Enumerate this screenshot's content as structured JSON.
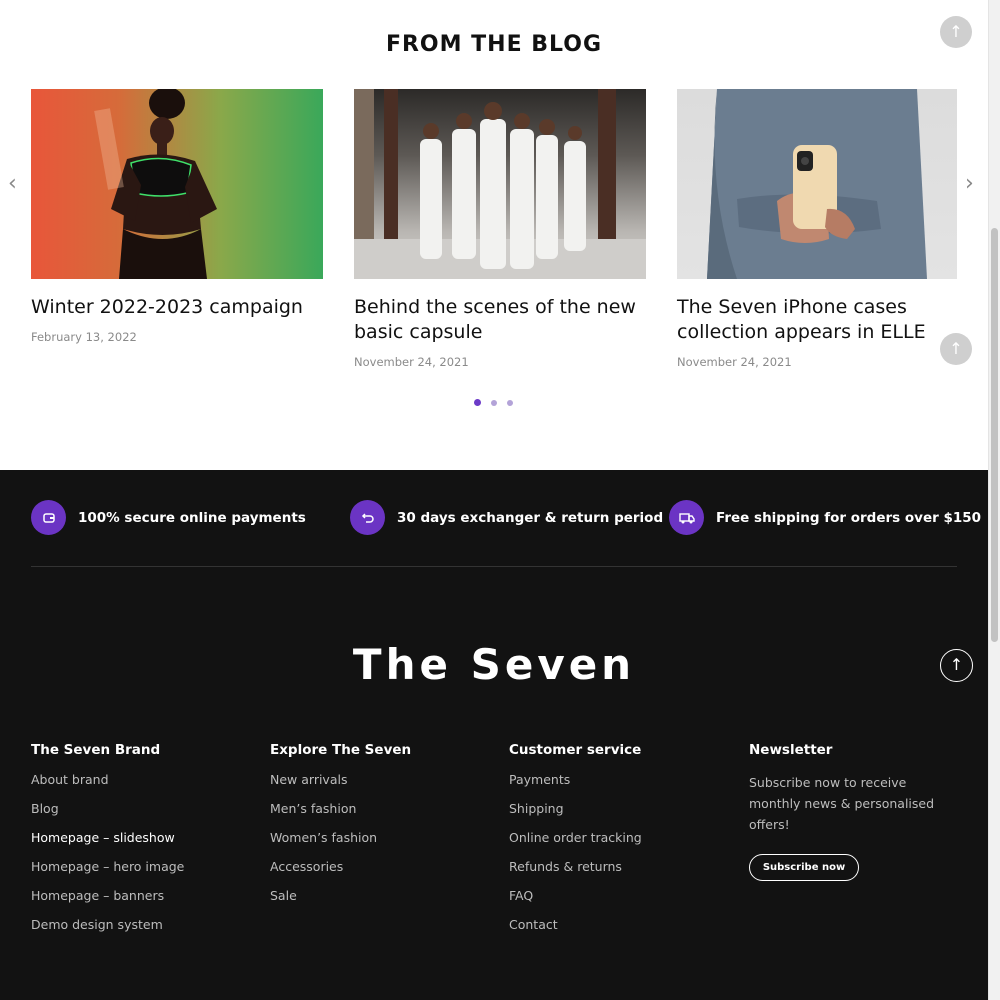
{
  "blog": {
    "title": "FROM THE BLOG",
    "posts": [
      {
        "title": "Winter 2022-2023 campaign",
        "date": "February 13, 2022"
      },
      {
        "title": "Behind the scenes of the new basic capsule",
        "date": "November 24, 2021"
      },
      {
        "title": "The Seven iPhone cases collection appears in ELLE",
        "date": "November 24, 2021"
      }
    ],
    "prev_icon": "chevron-left-icon",
    "next_icon": "chevron-right-icon",
    "slider_pages": 3,
    "active_page": 1
  },
  "features": [
    {
      "icon": "wallet-icon",
      "text": "100% secure online payments"
    },
    {
      "icon": "return-icon",
      "text": "30 days exchanger & return period"
    },
    {
      "icon": "truck-icon",
      "text": "Free shipping for orders over $150"
    }
  ],
  "footer": {
    "logo": "The Seven",
    "columns": [
      {
        "title": "The Seven Brand",
        "links": [
          "About brand",
          "Blog",
          "Homepage – slideshow",
          "Homepage – hero image",
          "Homepage – banners",
          "Demo design system"
        ]
      },
      {
        "title": "Explore The Seven",
        "links": [
          "New arrivals",
          "Men’s fashion",
          "Women’s fashion",
          "Accessories",
          "Sale"
        ]
      },
      {
        "title": "Customer service",
        "links": [
          "Payments",
          "Shipping",
          "Online order tracking",
          "Refunds & returns",
          "FAQ",
          "Contact"
        ]
      }
    ],
    "newsletter": {
      "title": "Newsletter",
      "text": "Subscribe now to receive monthly news & personalised offers!",
      "button": "Subscribe now"
    }
  },
  "colors": {
    "accent": "#6b34c4",
    "footer_bg": "#121212"
  }
}
